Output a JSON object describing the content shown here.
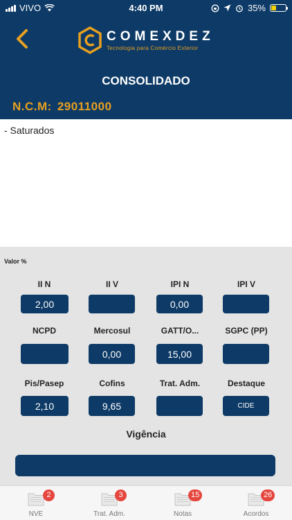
{
  "status_bar": {
    "carrier": "VIVO",
    "time": "4:40 PM",
    "battery": "35%",
    "battery_fill_fraction": 0.35
  },
  "header": {
    "brand_name": "COMEXDEZ",
    "brand_tagline": "Tecnologia para Comércio Exterior",
    "title": "CONSOLIDADO",
    "ncm_label": "N.C.M:",
    "ncm_value": "29011000"
  },
  "description": "- Saturados",
  "panel": {
    "valor_label": "Valor %",
    "rows": [
      {
        "cells": [
          {
            "label": "II N",
            "value": "2,00"
          },
          {
            "label": "II V",
            "value": ""
          },
          {
            "label": "IPI N",
            "value": "0,00"
          },
          {
            "label": "IPI V",
            "value": ""
          }
        ]
      },
      {
        "cells": [
          {
            "label": "NCPD",
            "value": ""
          },
          {
            "label": "Mercosul",
            "value": "0,00"
          },
          {
            "label": "GATT/O...",
            "value": "15,00"
          },
          {
            "label": "SGPC (PP)",
            "value": ""
          }
        ]
      },
      {
        "cells": [
          {
            "label": "Pis/Pasep",
            "value": "2,10"
          },
          {
            "label": "Cofins",
            "value": "9,65"
          },
          {
            "label": "Trat. Adm.",
            "value": ""
          },
          {
            "label": "Destaque",
            "value": "CIDE"
          }
        ]
      }
    ],
    "vigencia_label": "Vigência",
    "vigencia_value": ""
  },
  "tabs": [
    {
      "label": "NVE",
      "badge": "2"
    },
    {
      "label": "Trat. Adm.",
      "badge": "3"
    },
    {
      "label": "Notas",
      "badge": "15"
    },
    {
      "label": "Acordos",
      "badge": "26"
    }
  ],
  "colors": {
    "primary": "#0d3a66",
    "accent": "#e8a020",
    "badge": "#e5463e",
    "panel": "#e4e4e4"
  }
}
